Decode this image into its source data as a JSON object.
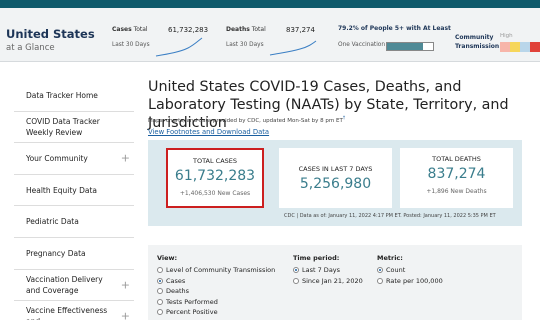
{
  "glance": {
    "title": "United States",
    "subtitle": "at a Glance",
    "cases": {
      "label_bold": "Cases",
      "label_rest": " Total",
      "value": "61,732,283",
      "sub": "Last 30 Days"
    },
    "deaths": {
      "label_bold": "Deaths",
      "label_rest": " Total",
      "value": "837,274",
      "sub": "Last 30 Days"
    },
    "vaccination": {
      "label": "79.2% of People 5+ with At Least",
      "sub": "One Vaccination",
      "fraction": 0.792
    },
    "transmission": {
      "label_line1": "Community",
      "label_line2": "Transmission",
      "high_label": "High",
      "swatches": [
        "#f7b5a9",
        "#f6d65a",
        "#b9d6ea",
        "#e0423a"
      ]
    },
    "colors": {
      "accent": "#0f5a6b",
      "spark": "#3b7fc4"
    }
  },
  "sidebar": {
    "items": [
      {
        "label": "Data Tracker Home",
        "expandable": false
      },
      {
        "label": "COVID Data Tracker Weekly Review",
        "expandable": false
      },
      {
        "label": "Your Community",
        "expandable": true
      },
      {
        "label": "Health Equity Data",
        "expandable": false
      },
      {
        "label": "Pediatric Data",
        "expandable": false
      },
      {
        "label": "Pregnancy Data",
        "expandable": false
      },
      {
        "label": "Vaccination Delivery and Coverage",
        "expandable": true
      },
      {
        "label": "Vaccine Effectiveness and",
        "expandable": true
      }
    ]
  },
  "main": {
    "title": "United States COVID-19 Cases, Deaths, and Laboratory Testing (NAATs) by State, Territory, and Jurisdiction",
    "maps_text": "Maps, charts, and data provided by CDC, updated Mon-Sat by 8 pm ET",
    "maps_sup": "†",
    "footnotes_link": "View Footnotes and Download Data"
  },
  "summary": {
    "total_cases": {
      "title": "TOTAL CASES",
      "value": "61,732,283",
      "sub": "+1,406,530 New Cases"
    },
    "last7": {
      "title": "CASES IN LAST 7 DAYS",
      "value": "5,256,980"
    },
    "total_deaths": {
      "title": "TOTAL DEATHS",
      "value": "837,274",
      "sub": "+1,896 New Deaths"
    },
    "cdc_line": "CDC | Data as of: January 11, 2022 4:17 PM ET. Posted: January 11, 2022 5:35 PM ET"
  },
  "filters": {
    "view": {
      "heading": "View:",
      "options": [
        {
          "label": "Level of Community Transmission",
          "checked": false
        },
        {
          "label": "Cases",
          "checked": true
        },
        {
          "label": "Deaths",
          "checked": false
        },
        {
          "label": "Tests Performed",
          "checked": false
        },
        {
          "label": "Percent Positive",
          "checked": false
        }
      ]
    },
    "time": {
      "heading": "Time period:",
      "options": [
        {
          "label": "Last 7 Days",
          "checked": true
        },
        {
          "label": "Since Jan 21, 2020",
          "checked": false
        }
      ]
    },
    "metric": {
      "heading": "Metric:",
      "options": [
        {
          "label": "Count",
          "checked": true
        },
        {
          "label": "Rate per 100,000",
          "checked": false
        }
      ]
    }
  }
}
